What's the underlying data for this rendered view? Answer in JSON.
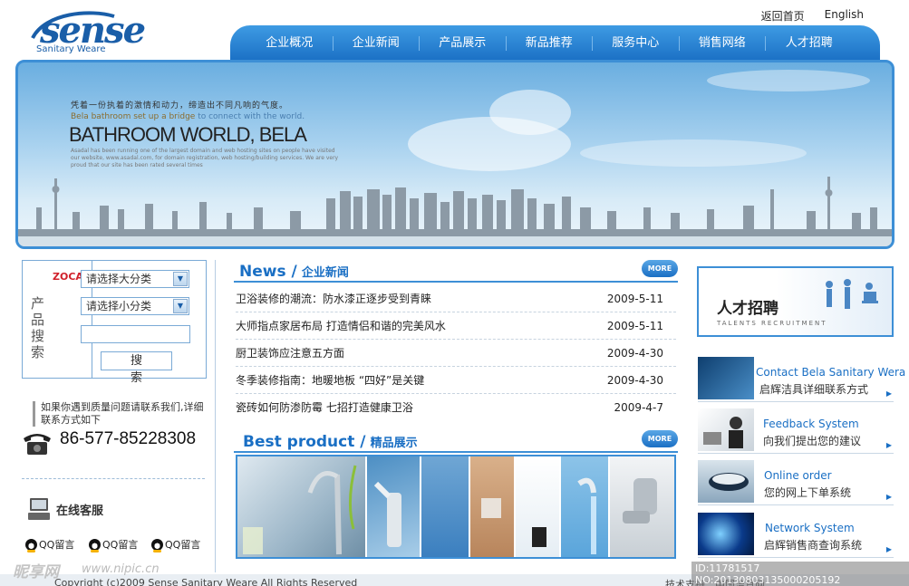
{
  "header": {
    "logo": {
      "text": "sense",
      "sub": "Sanitary Weare"
    },
    "top_links": [
      "返回首页",
      "English"
    ],
    "nav": [
      "企业概况",
      "企业新闻",
      "产品展示",
      "新品推荐",
      "服务中心",
      "销售网络",
      "人才招聘"
    ]
  },
  "banner": {
    "slogan": "凭着一份执着的激情和动力，缔造出不同凡响的气度。",
    "sub_a": "Bela bathroom set up a bridge ",
    "sub_b": "to connect with the world.",
    "title": "BATHROOM WORLD, BELA",
    "small": "Asadal has been running one of the largest domain and web hosting sites on people have visited our website, www.asadal.com, for domain registration, web hosting/building services. We are very proud that our site has been rated several times"
  },
  "search": {
    "zocale": "ZOCALE",
    "label": "产品搜索",
    "select1": "请选择大分类",
    "select2": "请选择小分类",
    "button": "搜 索"
  },
  "contact": {
    "text": "如果你遇到质量问题请联系我们,详细联系方式如下",
    "phone": "86-577-85228308",
    "online": "在线客服",
    "qq": [
      "QQ留言",
      "QQ留言",
      "QQ留言"
    ]
  },
  "news": {
    "title_en": "News /",
    "title_cn": "企业新闻",
    "more": "MORE",
    "items": [
      {
        "title": "卫浴装修的潮流：防水漆正逐步受到青睐",
        "date": "2009-5-11"
      },
      {
        "title": "大师指点家居布局 打造情侣和谐的完美风水",
        "date": "2009-5-11"
      },
      {
        "title": "厨卫装饰应注意五方面",
        "date": "2009-4-30"
      },
      {
        "title": "冬季装修指南：地暖地板 “四好”是关键",
        "date": "2009-4-30"
      },
      {
        "title": "瓷砖如何防渗防霉 七招打造健康卫浴",
        "date": "2009-4-7"
      }
    ]
  },
  "products": {
    "title_en": "Best product /",
    "title_cn": "精品展示",
    "more": "MORE"
  },
  "right": {
    "talent_title": "人才招聘",
    "talent_sub": "TALENTS RECRUITMENT",
    "services": [
      {
        "t1": "Contact Bela  Sanitary Wera",
        "t2": "启辉洁具详细联系方式"
      },
      {
        "t1": "Feedback  System",
        "t2": "向我们提出您的建议"
      },
      {
        "t1": "Online order",
        "t2": "您的网上下单系统"
      },
      {
        "t1": "Network System",
        "t2": "启辉销售商查询系统"
      }
    ]
  },
  "footer": {
    "copyright": "Copyright (c)2009  Sense  Sanitary Weare All Rights Reserved",
    "tech": "技术支持：中国洁具网"
  },
  "watermark": {
    "logo": "昵享网",
    "url": "www.nipic.cn",
    "id": "ID:11781517 NO:20130803135000205192"
  }
}
